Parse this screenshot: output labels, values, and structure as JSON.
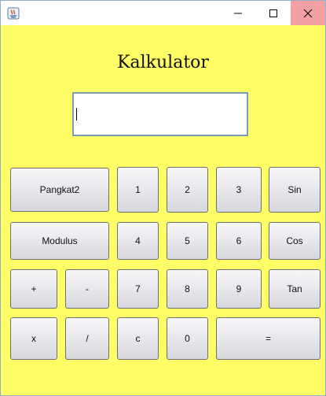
{
  "window": {
    "controls": {
      "minimize": "—",
      "maximize": "☐",
      "close": "✕"
    },
    "icon": "java-app-icon"
  },
  "heading": "Kalkulator",
  "display": {
    "value": ""
  },
  "buttons": {
    "pangkat2": "Pangkat2",
    "one": "1",
    "two": "2",
    "three": "3",
    "sin": "Sin",
    "modulus": "Modulus",
    "four": "4",
    "five": "5",
    "six": "6",
    "cos": "Cos",
    "plus": "+",
    "minus": "-",
    "seven": "7",
    "eight": "8",
    "nine": "9",
    "tan": "Tan",
    "multiply": "x",
    "divide": "/",
    "clear": "c",
    "zero": "0",
    "equals": "="
  },
  "colors": {
    "background": "#fffe66",
    "close_hover": "#f1a0a4",
    "display_border": "#7a9db8"
  }
}
